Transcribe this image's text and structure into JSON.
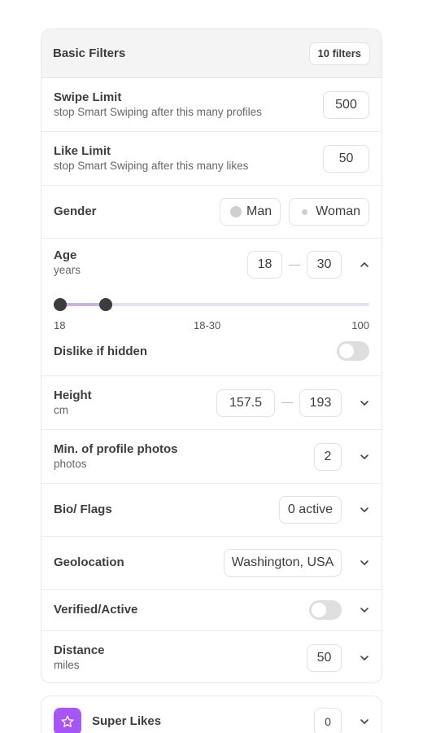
{
  "basic_filters": {
    "title": "Basic Filters",
    "badge": "10 filters"
  },
  "swipe_limit": {
    "title": "Swipe Limit",
    "subtitle": "stop Smart Swiping after this many profiles",
    "value": "500"
  },
  "like_limit": {
    "title": "Like Limit",
    "subtitle": "stop Smart Swiping after this many likes",
    "value": "50"
  },
  "gender": {
    "title": "Gender",
    "options": [
      "Man",
      "Woman"
    ]
  },
  "age": {
    "title": "Age",
    "subtitle": "years",
    "min_value": "18",
    "max_value": "30",
    "slider": {
      "min": 18,
      "max": 100,
      "low": 18,
      "high": 30
    },
    "slider_labels": {
      "min": "18",
      "range": "18-30",
      "max": "100"
    },
    "dislike_hidden_label": "Dislike if hidden",
    "dislike_hidden_on": false
  },
  "height": {
    "title": "Height",
    "subtitle": "cm",
    "min_value": "157.5",
    "max_value": "193"
  },
  "photos": {
    "title": "Min. of profile photos",
    "subtitle": "photos",
    "value": "2"
  },
  "bio_flags": {
    "title": "Bio/ Flags",
    "value": "0 active"
  },
  "geolocation": {
    "title": "Geolocation",
    "value": "Washington, USA"
  },
  "verified": {
    "title": "Verified/Active",
    "on": false
  },
  "distance": {
    "title": "Distance",
    "subtitle": "miles",
    "value": "50"
  },
  "super_likes": {
    "title": "Super Likes",
    "value": "0",
    "icon": "star-icon",
    "accent": "#a855f7"
  },
  "colors": {
    "slider_fill": "#c9b2e6",
    "slider_track": "#e6e1ec",
    "thumb": "#3d3d3d"
  }
}
